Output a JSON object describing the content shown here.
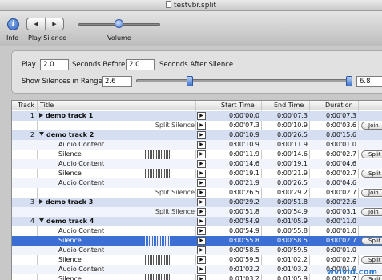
{
  "window": {
    "title": "testvbr.split"
  },
  "toolbar": {
    "info_label": "Info",
    "play_silence_label": "Play Silence",
    "volume_label": "Volume",
    "prev_glyph": "◀",
    "next_glyph": "▶"
  },
  "settings": {
    "play_label": "Play",
    "seconds_before_value": "2.0",
    "seconds_before_label": "Seconds Before,",
    "seconds_after_value": "2.0",
    "seconds_after_label": "Seconds After Silence",
    "range_label": "Show Silences in Range:",
    "range_min_value": "2.6",
    "range_max_value": "6.8"
  },
  "table": {
    "headers": {
      "track": "Track",
      "title": "Title",
      "start": "Start Time",
      "end": "End Time",
      "duration": "Duration"
    },
    "rows": [
      {
        "kind": "group",
        "track": "1",
        "title": "demo track 1",
        "split": "",
        "start": "0:00'00.0",
        "end": "0:00'07.3",
        "dur": "0:00'07.3",
        "btn": ""
      },
      {
        "kind": "item",
        "track": "",
        "title": "",
        "split": "Split Silence",
        "start": "0:00'07.3",
        "end": "0:00'10.9",
        "dur": "0:00'03.6",
        "btn": "Join"
      },
      {
        "kind": "group",
        "track": "2",
        "title": "demo track 2",
        "split": "",
        "start": "0:00'10.9",
        "end": "0:00'26.5",
        "dur": "0:00'15.6",
        "btn": ""
      },
      {
        "kind": "item",
        "track": "",
        "title": "Audio Content",
        "split": "",
        "start": "0:00'10.9",
        "end": "0:00'11.9",
        "dur": "0:00'01.0",
        "btn": ""
      },
      {
        "kind": "item",
        "track": "",
        "title": "Silence",
        "split": "",
        "wave": true,
        "start": "0:00'11.9",
        "end": "0:00'14.6",
        "dur": "0:00'02.7",
        "btn": "Split"
      },
      {
        "kind": "item",
        "track": "",
        "title": "Audio Content",
        "split": "",
        "start": "0:00'14.6",
        "end": "0:00'19.1",
        "dur": "0:00'04.6",
        "btn": ""
      },
      {
        "kind": "item",
        "track": "",
        "title": "Silence",
        "split": "",
        "wave": true,
        "start": "0:00'19.1",
        "end": "0:00'21.9",
        "dur": "0:00'02.7",
        "btn": "Split"
      },
      {
        "kind": "item",
        "track": "",
        "title": "Audio Content",
        "split": "",
        "start": "0:00'21.9",
        "end": "0:00'26.5",
        "dur": "0:00'04.6",
        "btn": ""
      },
      {
        "kind": "item",
        "track": "",
        "title": "",
        "split": "Split Silence",
        "start": "0:00'26.5",
        "end": "0:00'29.2",
        "dur": "0:00'02.7",
        "btn": "Join"
      },
      {
        "kind": "group",
        "track": "3",
        "title": "demo track 3",
        "split": "",
        "start": "0:00'29.2",
        "end": "0:00'51.8",
        "dur": "0:00'22.6",
        "btn": ""
      },
      {
        "kind": "item",
        "track": "",
        "title": "",
        "split": "Split Silence",
        "start": "0:00'51.8",
        "end": "0:00'54.9",
        "dur": "0:00'03.1",
        "btn": "Join"
      },
      {
        "kind": "group",
        "track": "4",
        "title": "demo track 4",
        "split": "",
        "start": "0:00'54.9",
        "end": "0:01'05.9",
        "dur": "0:00'11.0",
        "btn": ""
      },
      {
        "kind": "item",
        "track": "",
        "title": "Audio Content",
        "split": "",
        "start": "0:00'54.9",
        "end": "0:00'55.8",
        "dur": "0:00'01.0",
        "btn": ""
      },
      {
        "kind": "sel",
        "track": "",
        "title": "Silence",
        "split": "",
        "wave": true,
        "start": "0:00'55.8",
        "end": "0:00'58.5",
        "dur": "0:00'02.7",
        "btn": "Split"
      },
      {
        "kind": "item",
        "track": "",
        "title": "Audio Content",
        "split": "",
        "start": "0:00'58.5",
        "end": "0:00'59.5",
        "dur": "0:00'01.0",
        "btn": ""
      },
      {
        "kind": "item",
        "track": "",
        "title": "Silence",
        "split": "",
        "wave": true,
        "start": "0:00'59.5",
        "end": "0:01'02.2",
        "dur": "0:00'02.7",
        "btn": "Split"
      },
      {
        "kind": "item",
        "track": "",
        "title": "Audio Content",
        "split": "",
        "start": "0:01'02.2",
        "end": "0:01'03.2",
        "dur": "0:00'01.0",
        "btn": ""
      },
      {
        "kind": "item",
        "track": "",
        "title": "Silence",
        "split": "",
        "wave": true,
        "start": "0:01'03.2",
        "end": "0:01'05.9",
        "dur": "0:00'02.7",
        "btn": "Split"
      }
    ]
  },
  "watermark": "wvivid.com"
}
